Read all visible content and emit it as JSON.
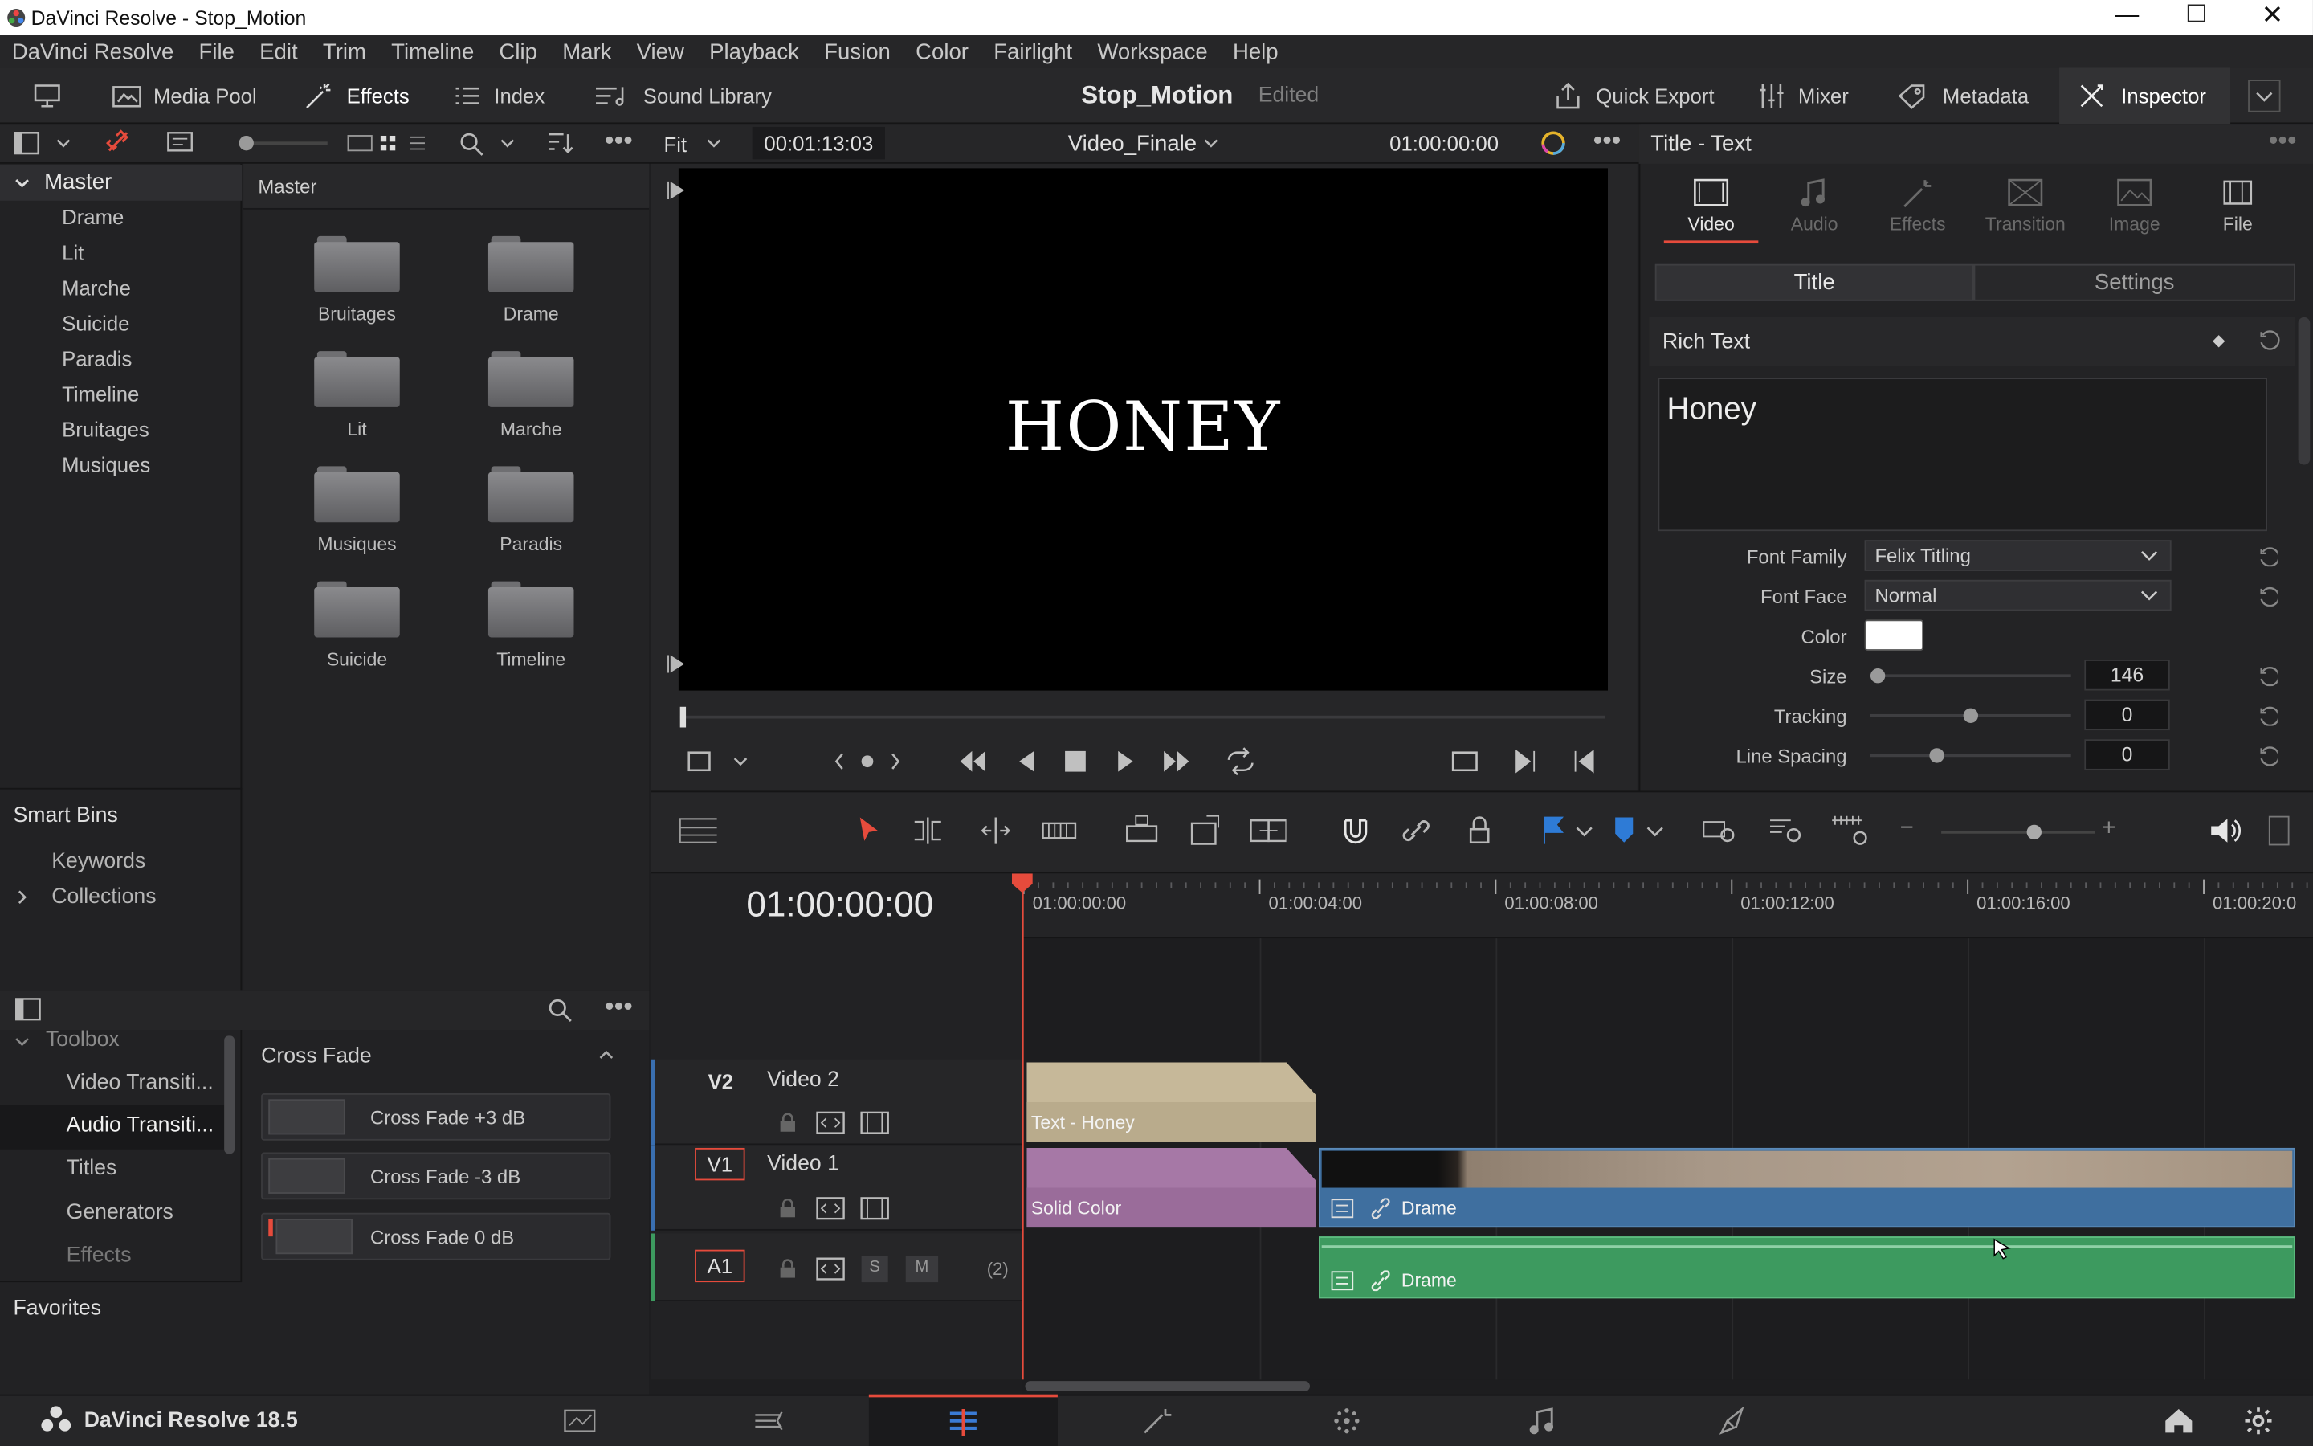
{
  "window": {
    "title": "DaVinci Resolve - Stop_Motion"
  },
  "menu": [
    "DaVinci Resolve",
    "File",
    "Edit",
    "Trim",
    "Timeline",
    "Clip",
    "Mark",
    "View",
    "Playback",
    "Fusion",
    "Color",
    "Fairlight",
    "Workspace",
    "Help"
  ],
  "toolbar": {
    "media_pool": "Media Pool",
    "effects": "Effects",
    "index": "Index",
    "sound_library": "Sound Library",
    "project": "Stop_Motion",
    "status": "Edited",
    "quick_export": "Quick Export",
    "mixer": "Mixer",
    "metadata": "Metadata",
    "inspector": "Inspector"
  },
  "bins": {
    "root": "Master",
    "items": [
      "Drame",
      "Lit",
      "Marche",
      "Suicide",
      "Paradis",
      "Timeline",
      "Bruitages",
      "Musiques"
    ],
    "smart_bins": "Smart Bins",
    "keywords": "Keywords",
    "collections": "Collections"
  },
  "pool": {
    "header": "Master",
    "folders": [
      "Bruitages",
      "Drame",
      "Lit",
      "Marche",
      "Musiques",
      "Paradis",
      "Suicide",
      "Timeline"
    ]
  },
  "viewer": {
    "fit": "Fit",
    "duration": "00:01:13:03",
    "timeline": "Video_Finale",
    "timecode": "01:00:00:00",
    "title_text": "HONEY"
  },
  "inspector": {
    "header": "Title - Text",
    "tabs": [
      "Video",
      "Audio",
      "Effects",
      "Transition",
      "Image",
      "File"
    ],
    "sub_tabs": [
      "Title",
      "Settings"
    ],
    "section": "Rich Text",
    "rich_text": "Honey",
    "font_family_label": "Font Family",
    "font_family": "Felix Titling",
    "font_face_label": "Font Face",
    "font_face": "Normal",
    "color_label": "Color",
    "text_color": "#ffffff",
    "size_label": "Size",
    "size": "146",
    "tracking_label": "Tracking",
    "tracking": "0",
    "line_spacing_label": "Line Spacing",
    "line_spacing": "0"
  },
  "toolbox": {
    "root": "Toolbox",
    "items": [
      "Video Transiti...",
      "Audio Transiti...",
      "Titles",
      "Generators",
      "Effects"
    ],
    "favorites": "Favorites"
  },
  "effects_list": {
    "header": "Cross Fade",
    "items": [
      "Cross Fade +3 dB",
      "Cross Fade -3 dB",
      "Cross Fade 0 dB"
    ]
  },
  "timeline": {
    "timecode": "01:00:00:00",
    "ruler": [
      "01:00:00:00",
      "01:00:04:00",
      "01:00:08:00",
      "01:00:12:00",
      "01:00:16:00",
      "01:00:20:0"
    ],
    "tracks": [
      {
        "id": "V2",
        "name": "Video 2"
      },
      {
        "id": "V1",
        "name": "Video 1"
      },
      {
        "id": "A1",
        "name": "",
        "solo": "S",
        "mute": "M",
        "channels": "(2)"
      }
    ],
    "clips": {
      "v2": "Text - Honey",
      "v1_a": "Solid Color",
      "v1_b": "Drame",
      "a1": "Drame"
    }
  },
  "footer": {
    "app": "DaVinci Resolve 18.5"
  },
  "colors": {
    "accent_red": "#e64b3c",
    "video_clip": "#3f6f9f",
    "audio_clip": "#3d9a5f",
    "title_clip": "#c6b899",
    "solid_clip": "#a678a6"
  }
}
